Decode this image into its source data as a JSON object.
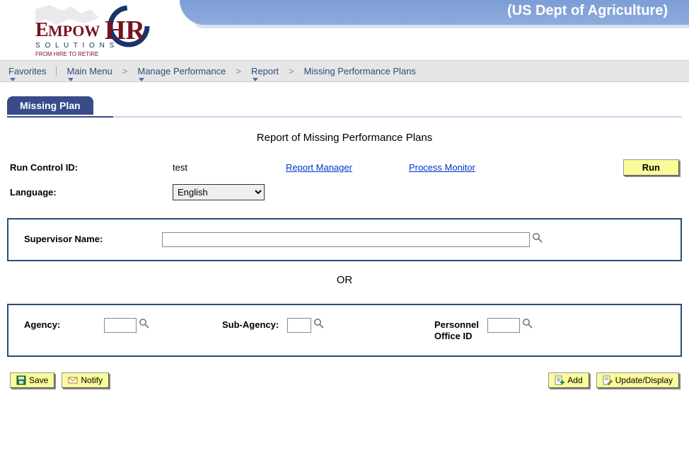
{
  "banner": {
    "title": "(US Dept of Agriculture)",
    "logo_main": "HR",
    "logo_brand": "EMPOW",
    "logo_sub1": "S O L U T I O N S",
    "logo_sub2": "FROM HIRE TO RETIRE"
  },
  "breadcrumb": {
    "favorites": "Favorites",
    "main_menu": "Main Menu",
    "manage_performance": "Manage Performance",
    "report": "Report",
    "missing_plans": "Missing Performance Plans"
  },
  "tab": {
    "label": "Missing Plan"
  },
  "page_title": "Report of Missing Performance Plans",
  "run": {
    "control_label": "Run Control ID:",
    "control_value": "test",
    "report_manager": "Report Manager",
    "process_monitor": "Process Monitor",
    "run_button": "Run",
    "language_label": "Language:",
    "language_value": "English"
  },
  "form": {
    "supervisor_label": "Supervisor Name:",
    "supervisor_value": "",
    "or_text": "OR",
    "agency_label": "Agency:",
    "agency_value": "",
    "subagency_label": "Sub-Agency:",
    "subagency_value": "",
    "personnel_label_line1": "Personnel",
    "personnel_label_line2": "Office ID",
    "personnel_value": ""
  },
  "actions": {
    "save": "Save",
    "notify": "Notify",
    "add": "Add",
    "update": "Update/Display"
  }
}
